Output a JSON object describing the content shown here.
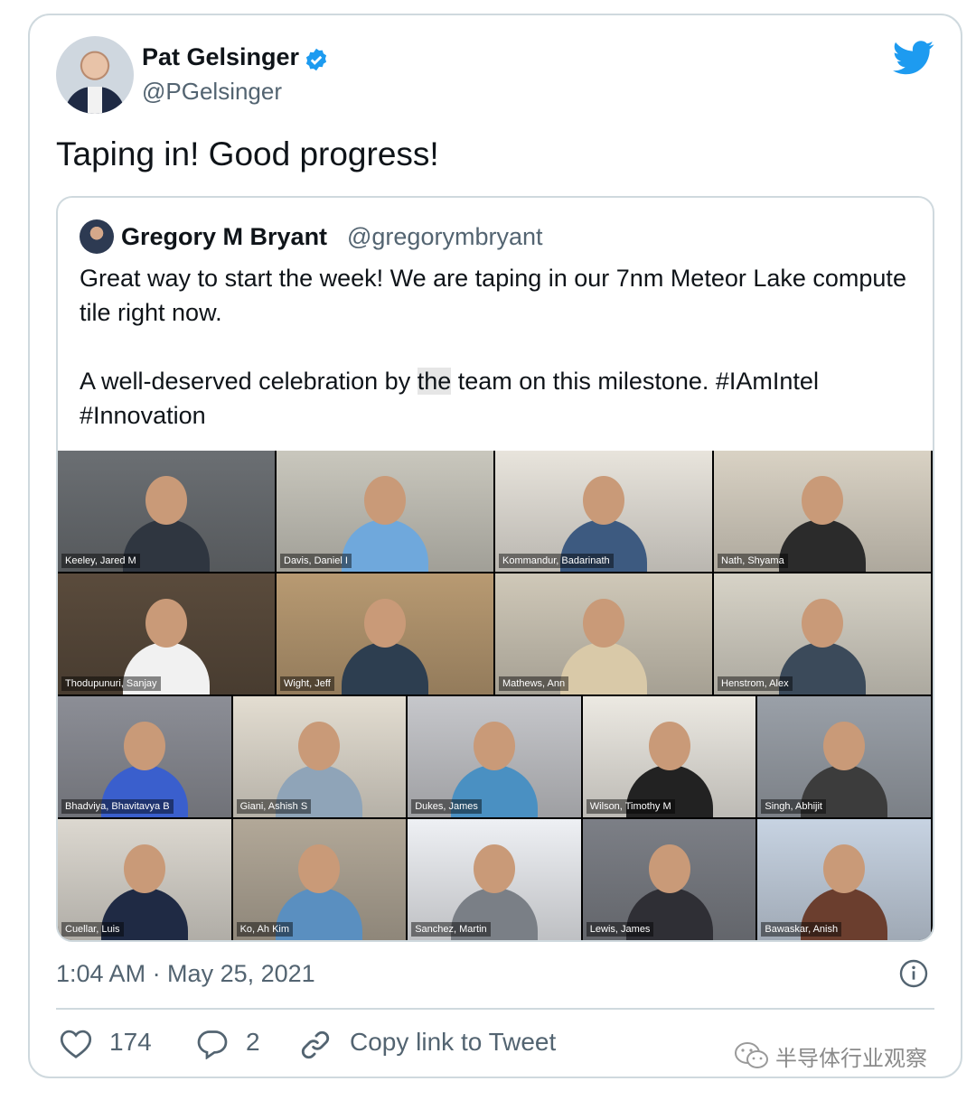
{
  "tweet": {
    "author_name": "Pat Gelsinger",
    "author_handle": "@PGelsinger",
    "text": "Taping in! Good progress!",
    "timestamp": "1:04 AM · May 25, 2021"
  },
  "quoted": {
    "author_name": "Gregory M Bryant",
    "author_handle": "@gregorymbryant",
    "line1": "Great way to start the week! We are taping in our 7nm Meteor Lake compute tile right now.",
    "line2_before": "A well-deserved celebration by ",
    "line2_highlight": "the",
    "line2_after": " team on this milestone. #IAmIntel #Innovation"
  },
  "participants": [
    "Keeley, Jared M",
    "Davis, Daniel I",
    "Kommandur, Badarinath",
    "Nath, Shyama",
    "Thodupunuri, Sanjay",
    "Wight, Jeff",
    "Mathews, Ann",
    "Henstrom, Alex",
    "Bhadviya, Bhavitavya B",
    "Giani, Ashish S",
    "Dukes, James",
    "Wilson, Timothy M",
    "Singh, Abhijit",
    "Cuellar, Luis",
    "Ko, Ah Kim",
    "Sanchez, Martin",
    "Lewis, James",
    "Bawaskar, Anish"
  ],
  "actions": {
    "likes": "174",
    "replies": "2",
    "copy_link": "Copy link to Tweet"
  },
  "watermark": "半导体行业观察",
  "colors": {
    "brand": "#1d9bf0",
    "secondary_text": "#536471",
    "border": "#cfd9de"
  },
  "icons": [
    "verified-badge-icon",
    "twitter-bird-icon",
    "info-icon",
    "heart-icon",
    "reply-icon",
    "link-icon",
    "wechat-icon"
  ]
}
